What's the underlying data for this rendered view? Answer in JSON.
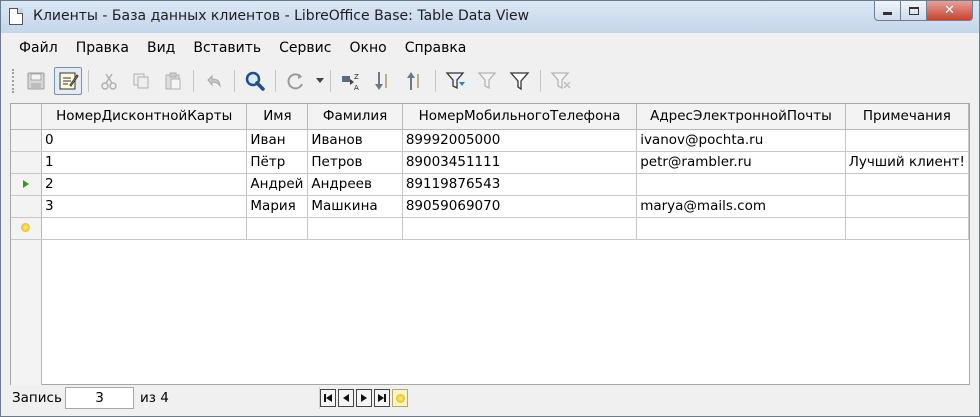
{
  "window": {
    "title": "Клиенты - База данных клиентов - LibreOffice Base: Table Data View"
  },
  "menu": {
    "items": [
      "Файл",
      "Правка",
      "Вид",
      "Вставить",
      "Сервис",
      "Окно",
      "Справка"
    ]
  },
  "toolbar": {
    "buttons": [
      {
        "name": "save-icon"
      },
      {
        "name": "edit-data-icon",
        "active": true
      },
      {
        "name": "cut-icon"
      },
      {
        "name": "copy-icon"
      },
      {
        "name": "paste-icon"
      },
      {
        "name": "undo-icon"
      },
      {
        "name": "find-record-icon"
      },
      {
        "name": "refresh-icon"
      },
      {
        "name": "sort-icon"
      },
      {
        "name": "sort-ascending-icon"
      },
      {
        "name": "sort-descending-icon"
      },
      {
        "name": "autofilter-icon"
      },
      {
        "name": "apply-filter-icon"
      },
      {
        "name": "standard-filter-icon"
      },
      {
        "name": "reset-filter-icon"
      }
    ]
  },
  "table": {
    "columns": [
      "НомерДисконтнойКарты",
      "Имя",
      "Фамилия",
      "НомерМобильногоТелефона",
      "АдресЭлектроннойПочты",
      "Примечания"
    ],
    "rows": [
      [
        "0",
        "Иван",
        "Иванов",
        "89992005000",
        "ivanov@pochta.ru",
        ""
      ],
      [
        "1",
        "Пётр",
        "Петров",
        "89003451111",
        "petr@rambler.ru",
        "Лучший клиент!"
      ],
      [
        "2",
        "Андрей",
        "Андреев",
        "89119876543",
        "",
        ""
      ],
      [
        "3",
        "Мария",
        "Машкина",
        "89059069070",
        "marya@mails.com",
        ""
      ]
    ],
    "current_row_index": 2
  },
  "status": {
    "record_label": "Запись",
    "record_value": "3",
    "of_label": "из 4"
  },
  "colors": {
    "title_bar": "#c4d6ea",
    "close_button": "#c7432f",
    "current_row_marker": "#3a9a2a",
    "new_row_marker": "#e0a800"
  }
}
